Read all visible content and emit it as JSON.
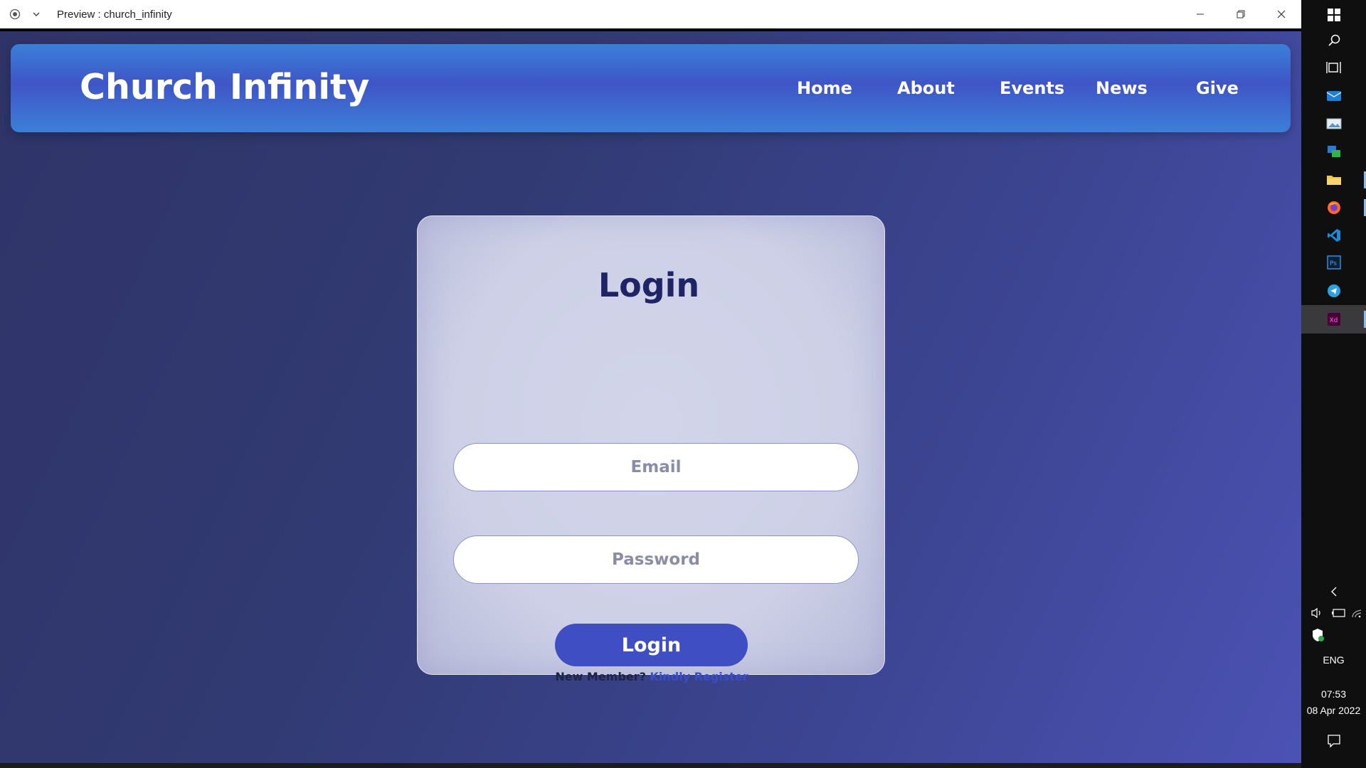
{
  "window": {
    "title": "Preview : church_infinity",
    "controls": {
      "minimize": "minimize-icon",
      "restore": "restore-icon",
      "close": "close-icon"
    }
  },
  "site": {
    "brand": "Church Infinity",
    "nav": [
      {
        "label": "Home"
      },
      {
        "label": "About"
      },
      {
        "label": "Events"
      },
      {
        "label": "News"
      },
      {
        "label": "Give"
      }
    ]
  },
  "login": {
    "title": "Login",
    "email_placeholder": "Email",
    "password_placeholder": "Password",
    "submit_label": "Login",
    "new_member_text": "New Member?",
    "register_link": "Kindly Register"
  },
  "taskbar": {
    "apps": [
      "windows-start-icon",
      "search-icon",
      "task-view-icon",
      "mail-icon",
      "photos-icon",
      "remote-app-icon",
      "file-explorer-icon",
      "firefox-icon",
      "vscode-icon",
      "photoshop-icon",
      "telegram-icon",
      "adobe-xd-icon"
    ],
    "tray": {
      "language": "ENG",
      "time": "07:53",
      "date": "08 Apr 2022"
    }
  },
  "colors": {
    "navbar_blue": "#3b7fd8",
    "page_background": "#313a72",
    "card_background": "#cdd0e6",
    "button_blue": "#3f4ec3",
    "title_navy": "#1e2466",
    "link_blue": "#3a4ec9"
  }
}
